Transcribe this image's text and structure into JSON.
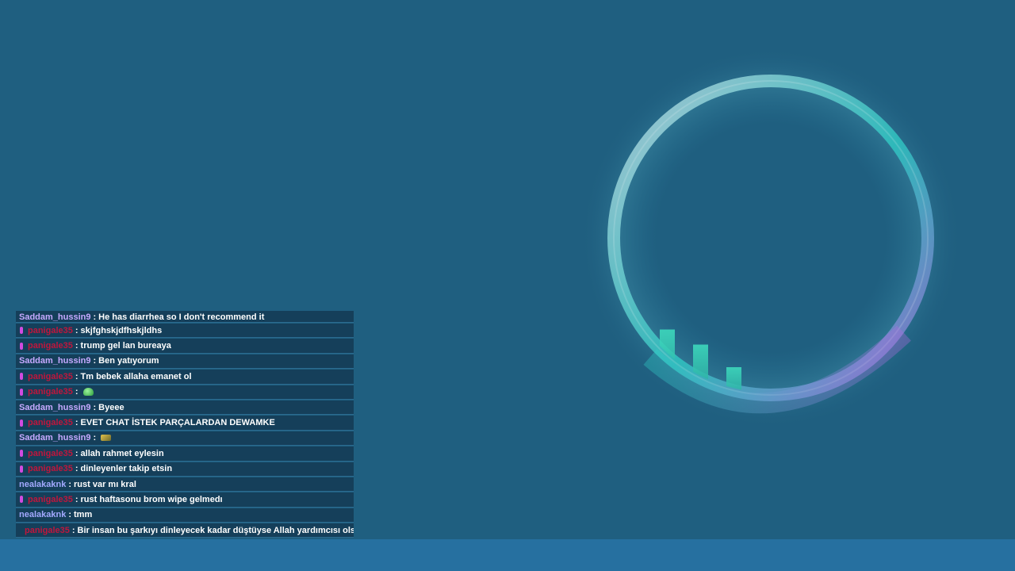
{
  "colors": {
    "background": "#1f5f80",
    "bottom_bar": "#2670a0",
    "row_bg": "#153f5a",
    "row_border": "#2b6a8f",
    "message_text": "#ffffff",
    "badge": "#d24be0"
  },
  "chat": {
    "messages": [
      {
        "user": "Saddam_hussin9",
        "user_color": "#c6a9ff",
        "badge": false,
        "text": "He has diarrhea so I don't recommend it",
        "emote": null
      },
      {
        "user": "panigale35",
        "user_color": "#c0163c",
        "badge": true,
        "text": "skjfghskjdfhskjldhs",
        "emote": null
      },
      {
        "user": "panigale35",
        "user_color": "#c0163c",
        "badge": true,
        "text": "trump gel lan bureaya",
        "emote": null
      },
      {
        "user": "Saddam_hussin9",
        "user_color": "#c6a9ff",
        "badge": false,
        "text": "Ben yatıyorum",
        "emote": null
      },
      {
        "user": "panigale35",
        "user_color": "#c0163c",
        "badge": true,
        "text": "Tm bebek allaha emanet ol",
        "emote": null
      },
      {
        "user": "panigale35",
        "user_color": "#c0163c",
        "badge": true,
        "text": "",
        "emote": "green-emote-icon"
      },
      {
        "user": "Saddam_hussin9",
        "user_color": "#c6a9ff",
        "badge": false,
        "text": "Byeee",
        "emote": null
      },
      {
        "user": "panigale35",
        "user_color": "#c0163c",
        "badge": true,
        "text": "EVET CHAT İSTEK PARÇALARDAN DEWAMKE",
        "emote": null
      },
      {
        "user": "Saddam_hussin9",
        "user_color": "#c6a9ff",
        "badge": false,
        "text": "",
        "emote": "gold-emote-icon"
      },
      {
        "user": "panigale35",
        "user_color": "#c0163c",
        "badge": true,
        "text": "allah rahmet eylesin",
        "emote": null
      },
      {
        "user": "panigale35",
        "user_color": "#c0163c",
        "badge": true,
        "text": "dinleyenler takip etsin",
        "emote": null
      },
      {
        "user": "nealakaknk",
        "user_color": "#a3a9ff",
        "badge": false,
        "text": "rust var mı kral",
        "emote": null
      },
      {
        "user": "panigale35",
        "user_color": "#c0163c",
        "badge": true,
        "text": "rust haftasonu brom wipe gelmedı",
        "emote": null
      },
      {
        "user": "nealakaknk",
        "user_color": "#a3a9ff",
        "badge": false,
        "text": "tmm",
        "emote": null
      },
      {
        "user": "panigale35",
        "user_color": "#c0163c",
        "badge": true,
        "text": "Bir insan bu şarkıyı dinleyecek kadar düştüyse Allah yardımcısı olsun",
        "emote": null
      }
    ]
  },
  "visualizer": {
    "icon": "audio-visualizer-ring-icon",
    "ring_colors": [
      "#d8e6ee",
      "#2fd0c8",
      "#b06ae0"
    ],
    "bar_levels": [
      0.05,
      0.15,
      0.55,
      0.1,
      0.45,
      0.08,
      0.3,
      0.05,
      0.05,
      0.05,
      0.05,
      0.05,
      0.05,
      0.05,
      0.05,
      0.05,
      0.18,
      0.15,
      0.22,
      0.08
    ]
  }
}
